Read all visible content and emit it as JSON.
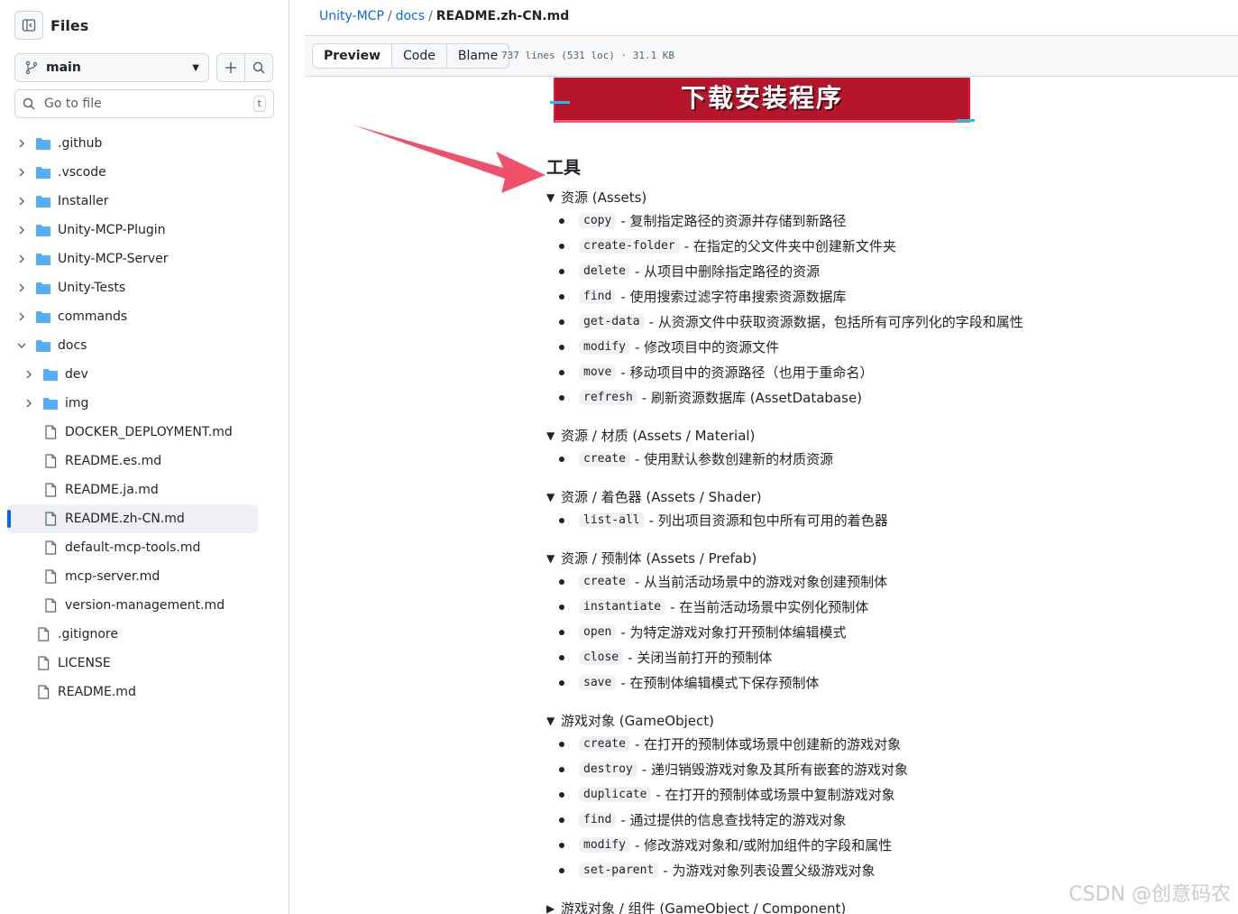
{
  "sidebar": {
    "title": "Files",
    "branch": "main",
    "search_placeholder": "Go to file",
    "search_shortcut": "t",
    "tree": [
      {
        "label": ".github",
        "kind": "folder",
        "depth": 0,
        "open": false
      },
      {
        "label": ".vscode",
        "kind": "folder",
        "depth": 0,
        "open": false
      },
      {
        "label": "Installer",
        "kind": "folder",
        "depth": 0,
        "open": false
      },
      {
        "label": "Unity-MCP-Plugin",
        "kind": "folder",
        "depth": 0,
        "open": false
      },
      {
        "label": "Unity-MCP-Server",
        "kind": "folder",
        "depth": 0,
        "open": false
      },
      {
        "label": "Unity-Tests",
        "kind": "folder",
        "depth": 0,
        "open": false
      },
      {
        "label": "commands",
        "kind": "folder",
        "depth": 0,
        "open": false
      },
      {
        "label": "docs",
        "kind": "folder",
        "depth": 0,
        "open": true
      },
      {
        "label": "dev",
        "kind": "folder",
        "depth": 1,
        "open": false
      },
      {
        "label": "img",
        "kind": "folder",
        "depth": 1,
        "open": false
      },
      {
        "label": "DOCKER_DEPLOYMENT.md",
        "kind": "file",
        "depth": 1
      },
      {
        "label": "README.es.md",
        "kind": "file",
        "depth": 1
      },
      {
        "label": "README.ja.md",
        "kind": "file",
        "depth": 1
      },
      {
        "label": "README.zh-CN.md",
        "kind": "file",
        "depth": 1,
        "active": true
      },
      {
        "label": "default-mcp-tools.md",
        "kind": "file",
        "depth": 1
      },
      {
        "label": "mcp-server.md",
        "kind": "file",
        "depth": 1
      },
      {
        "label": "version-management.md",
        "kind": "file",
        "depth": 1
      },
      {
        "label": ".gitignore",
        "kind": "file",
        "depth": 0
      },
      {
        "label": "LICENSE",
        "kind": "file",
        "depth": 0
      },
      {
        "label": "README.md",
        "kind": "file",
        "depth": 0
      }
    ]
  },
  "breadcrumb": {
    "repo": "Unity-MCP",
    "folder": "docs",
    "file": "README.zh-CN.md",
    "sep": "/"
  },
  "toolbar": {
    "preview": "Preview",
    "code": "Code",
    "blame": "Blame",
    "meta": "737 lines (531 loc) · 31.1 KB"
  },
  "banner_text": "下载安装程序",
  "doc": {
    "heading": "工具",
    "groups": [
      {
        "title": "资源 (Assets)",
        "open": true,
        "items": [
          {
            "code": "copy",
            "desc": "- 复制指定路径的资源并存储到新路径"
          },
          {
            "code": "create-folder",
            "desc": "- 在指定的父文件夹中创建新文件夹"
          },
          {
            "code": "delete",
            "desc": "- 从项目中删除指定路径的资源"
          },
          {
            "code": "find",
            "desc": "- 使用搜索过滤字符串搜索资源数据库"
          },
          {
            "code": "get-data",
            "desc": "- 从资源文件中获取资源数据，包括所有可序列化的字段和属性"
          },
          {
            "code": "modify",
            "desc": "- 修改项目中的资源文件"
          },
          {
            "code": "move",
            "desc": "- 移动项目中的资源路径（也用于重命名）"
          },
          {
            "code": "refresh",
            "desc": "- 刷新资源数据库 (AssetDatabase)"
          }
        ]
      },
      {
        "title": "资源 / 材质 (Assets / Material)",
        "open": true,
        "items": [
          {
            "code": "create",
            "desc": "- 使用默认参数创建新的材质资源"
          }
        ]
      },
      {
        "title": "资源 / 着色器 (Assets / Shader)",
        "open": true,
        "items": [
          {
            "code": "list-all",
            "desc": "- 列出项目资源和包中所有可用的着色器"
          }
        ]
      },
      {
        "title": "资源 / 预制体 (Assets / Prefab)",
        "open": true,
        "items": [
          {
            "code": "create",
            "desc": "- 从当前活动场景中的游戏对象创建预制体"
          },
          {
            "code": "instantiate",
            "desc": "- 在当前活动场景中实例化预制体"
          },
          {
            "code": "open",
            "desc": "- 为特定游戏对象打开预制体编辑模式"
          },
          {
            "code": "close",
            "desc": "- 关闭当前打开的预制体"
          },
          {
            "code": "save",
            "desc": "- 在预制体编辑模式下保存预制体"
          }
        ]
      },
      {
        "title": "游戏对象 (GameObject)",
        "open": true,
        "items": [
          {
            "code": "create",
            "desc": "- 在打开的预制体或场景中创建新的游戏对象"
          },
          {
            "code": "destroy",
            "desc": "- 递归销毁游戏对象及其所有嵌套的游戏对象"
          },
          {
            "code": "duplicate",
            "desc": "- 在打开的预制体或场景中复制游戏对象"
          },
          {
            "code": "find",
            "desc": "- 通过提供的信息查找特定的游戏对象"
          },
          {
            "code": "modify",
            "desc": "- 修改游戏对象和/或附加组件的字段和属性"
          },
          {
            "code": "set-parent",
            "desc": "- 为游戏对象列表设置父级游戏对象"
          }
        ]
      },
      {
        "title": "游戏对象 / 组件 (GameObject / Component)",
        "open": false,
        "items": []
      }
    ]
  },
  "watermark": "CSDN @创意码农",
  "colors": {
    "link": "#0969da",
    "arrow": "#f0506a",
    "banner": "#b5162b"
  }
}
